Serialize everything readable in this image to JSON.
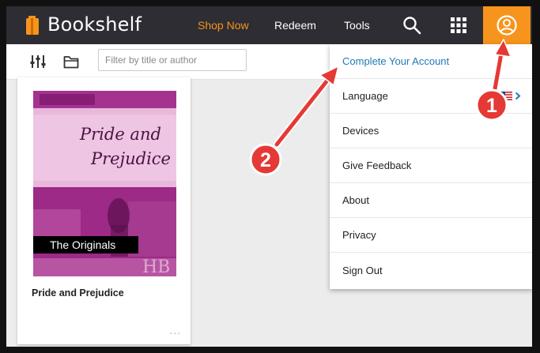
{
  "topbar": {
    "brand": "Bookshelf",
    "nav": [
      "Shop Now",
      "Redeem",
      "Tools"
    ],
    "icons": [
      "search-icon",
      "apps-grid-icon",
      "account-icon"
    ]
  },
  "toolbar": {
    "filter_placeholder": "Filter by title or author"
  },
  "book": {
    "cover_title_line1": "Pride and",
    "cover_title_line2": "Prejudice",
    "series_label": "The Originals",
    "watermark": "HB",
    "title": "Pride and Prejudice",
    "more": "..."
  },
  "menu": {
    "items": [
      "Complete Your Account",
      "Language",
      "Devices",
      "Give Feedback",
      "About",
      "Privacy",
      "Sign Out"
    ]
  },
  "annotations": [
    "1",
    "2"
  ],
  "colors": {
    "topbar": "#2d2d33",
    "brand_orange": "#f7941d",
    "link_blue": "#1f7ab5",
    "annotation_red": "#e53935",
    "cover_magenta": "#8b1a7a"
  }
}
